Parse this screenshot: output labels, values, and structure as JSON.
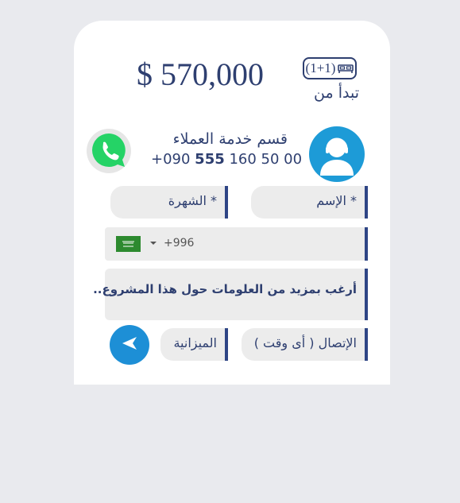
{
  "listing": {
    "price": "$ 570,000",
    "rooms_badge": "(1+1)",
    "starts_from": "تبدأ من"
  },
  "support": {
    "title": "قسم خدمة العملاء",
    "phone_prefix": "+090 ",
    "phone_bold": "555",
    "phone_rest": " 160 50 00"
  },
  "form": {
    "name_placeholder": "* الإسم",
    "title_placeholder": "* الشهرة",
    "country_dial_code": "+996",
    "message_text": "أرغب بمزيد من العلومات  حول هذا المشروع..",
    "contact_time_label": "الإتصال ( أى وقت )",
    "budget_label": "الميزانية"
  },
  "colors": {
    "text_navy": "#2e3f70",
    "accent_blue": "#1d9bd7",
    "field_bg": "#ececec",
    "whatsapp_green": "#25d366"
  },
  "icons": [
    "bed-icon",
    "support-agent-icon",
    "whatsapp-icon",
    "saudi-flag-icon",
    "send-arrow-icon"
  ]
}
